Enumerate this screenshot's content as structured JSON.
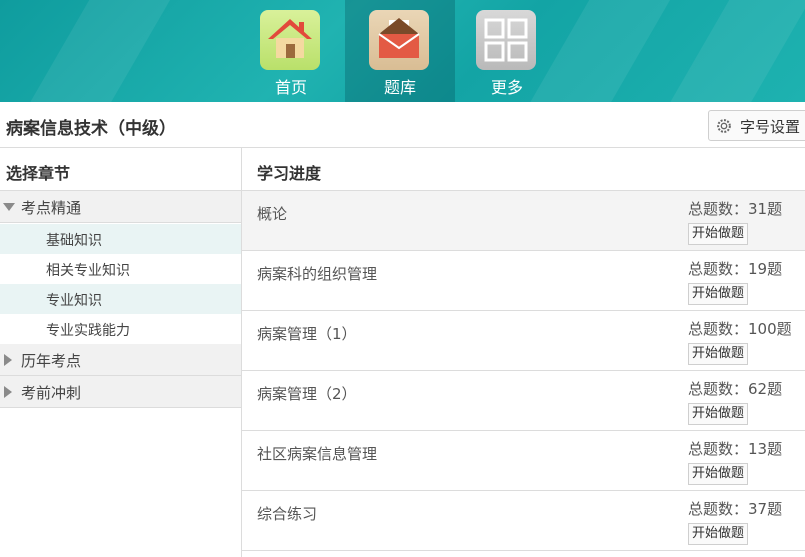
{
  "nav": {
    "items": [
      {
        "label": "首页",
        "icon": "home-icon"
      },
      {
        "label": "题库",
        "icon": "envelope-icon"
      },
      {
        "label": "更多",
        "icon": "grid-icon"
      }
    ],
    "active_index": 1
  },
  "course": {
    "title": "病案信息技术（中级）",
    "font_setting_label": "字号设置"
  },
  "left_panel": {
    "header": "选择章节",
    "groups": [
      {
        "label": "考点精通",
        "expanded": true,
        "items": [
          "基础知识",
          "相关专业知识",
          "专业知识",
          "专业实践能力"
        ]
      },
      {
        "label": "历年考点",
        "expanded": false
      },
      {
        "label": "考前冲刺",
        "expanded": false
      }
    ]
  },
  "right_panel": {
    "header": "学习进度",
    "button_label": "开始做题",
    "rows": [
      {
        "name": "概论",
        "count": "总题数：31题"
      },
      {
        "name": "病案科的组织管理",
        "count": "总题数：19题"
      },
      {
        "name": "病案管理（1）",
        "count": "总题数：100题"
      },
      {
        "name": "病案管理（2）",
        "count": "总题数：62题"
      },
      {
        "name": "社区病案信息管理",
        "count": "总题数：13题"
      },
      {
        "name": "综合练习",
        "count": "总题数：37题"
      }
    ]
  },
  "colors": {
    "nav_teal": "#1aa9a9",
    "active_tab": "#0e7f84",
    "highlight_row": "#e9f4f4"
  }
}
